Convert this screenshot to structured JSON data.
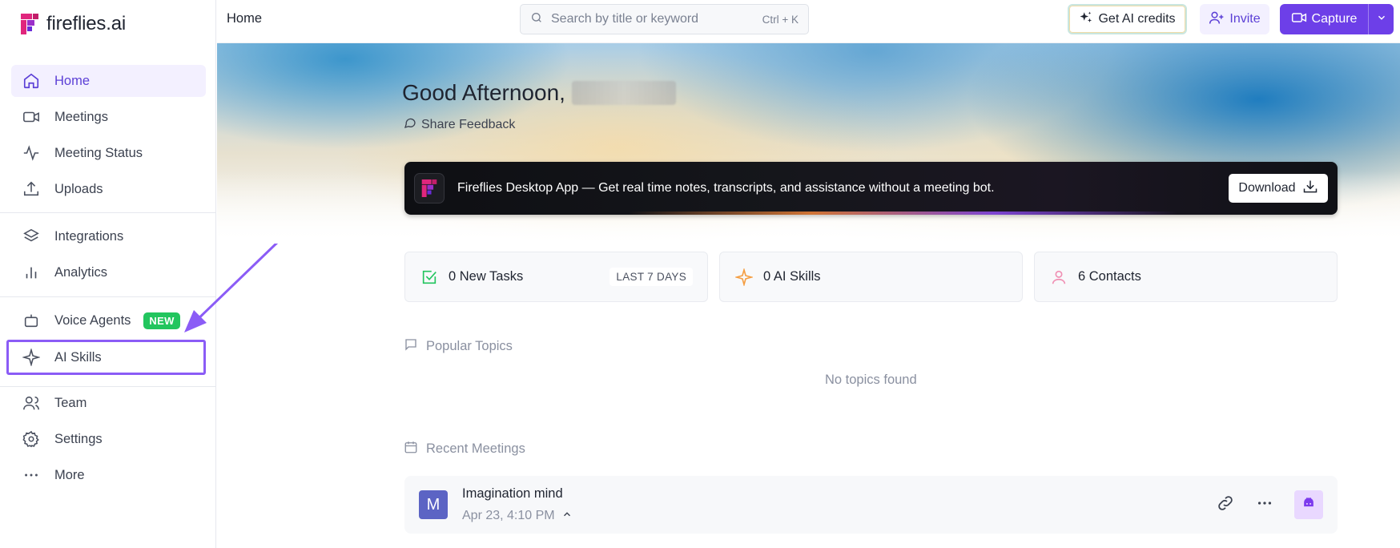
{
  "app": {
    "logo_text": "fireflies.ai"
  },
  "sidebar": {
    "items": [
      {
        "label": "Home",
        "icon": "home-icon"
      },
      {
        "label": "Meetings",
        "icon": "video-icon"
      },
      {
        "label": "Meeting Status",
        "icon": "activity-icon"
      },
      {
        "label": "Uploads",
        "icon": "upload-icon"
      },
      {
        "label": "Integrations",
        "icon": "layers-icon"
      },
      {
        "label": "Analytics",
        "icon": "bar-chart-icon"
      },
      {
        "label": "Voice Agents",
        "icon": "bot-icon",
        "badge": "NEW"
      },
      {
        "label": "AI Skills",
        "icon": "sparkle-icon"
      },
      {
        "label": "Team",
        "icon": "users-icon"
      },
      {
        "label": "Settings",
        "icon": "gear-icon"
      },
      {
        "label": "More",
        "icon": "ellipsis-icon"
      }
    ]
  },
  "topbar": {
    "breadcrumb": "Home",
    "search_placeholder": "Search by title or keyword",
    "search_shortcut": "Ctrl + K",
    "credits_label": "Get AI credits",
    "invite_label": "Invite",
    "capture_label": "Capture"
  },
  "hero": {
    "greeting": "Good Afternoon,",
    "feedback_label": "Share Feedback"
  },
  "banner": {
    "text": "Fireflies Desktop App — Get real time notes, transcripts, and assistance without a meeting bot.",
    "download_label": "Download"
  },
  "stats": [
    {
      "label": "0 New Tasks",
      "tag": "LAST 7 DAYS",
      "icon": "check-square-icon"
    },
    {
      "label": "0 AI Skills",
      "icon": "sparkle-icon"
    },
    {
      "label": "6 Contacts",
      "icon": "user-icon"
    }
  ],
  "popular_topics": {
    "title": "Popular Topics",
    "empty": "No topics found"
  },
  "recent_meetings": {
    "title": "Recent Meetings",
    "items": [
      {
        "avatar": "M",
        "title": "Imagination mind",
        "date": "Apr 23, 4:10 PM"
      }
    ]
  },
  "colors": {
    "accent": "#6d3fe8",
    "highlight": "#8b5cf6",
    "badge": "#22c55e"
  }
}
